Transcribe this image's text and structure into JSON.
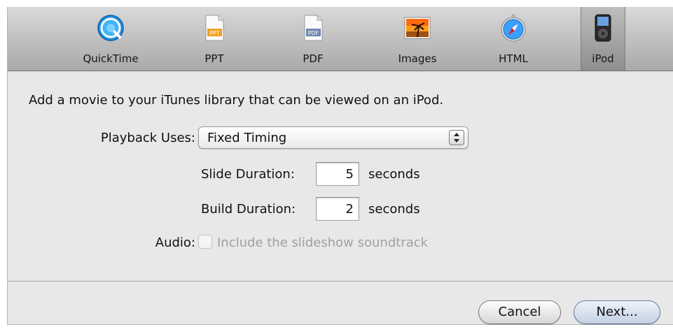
{
  "toolbar": {
    "tabs": [
      {
        "label": "QuickTime",
        "icon": "quicktime-icon"
      },
      {
        "label": "PPT",
        "icon": "ppt-document-icon",
        "badge": "PPT"
      },
      {
        "label": "PDF",
        "icon": "pdf-document-icon",
        "badge": "PDF"
      },
      {
        "label": "Images",
        "icon": "beach-photo-icon"
      },
      {
        "label": "HTML",
        "icon": "safari-compass-icon"
      },
      {
        "label": "iPod",
        "icon": "ipod-icon"
      }
    ],
    "selected_tab": "iPod"
  },
  "main": {
    "description": "Add a movie to your iTunes library that can be viewed on an iPod.",
    "playback": {
      "label": "Playback Uses:",
      "value": "Fixed Timing"
    },
    "slide_duration": {
      "label": "Slide Duration:",
      "value": "5",
      "unit": "seconds"
    },
    "build_duration": {
      "label": "Build Duration:",
      "value": "2",
      "unit": "seconds"
    },
    "audio": {
      "label": "Audio:",
      "checkbox_label": "Include the slideshow soundtrack",
      "checked": false,
      "enabled": false
    }
  },
  "footer": {
    "cancel_label": "Cancel",
    "next_label": "Next..."
  },
  "colors": {
    "toolbar_top": "#d9d9d9",
    "toolbar_bottom": "#a9a9a9",
    "panel_bg": "#e8e8e8",
    "disabled_text": "#a0a0a0",
    "default_button": "#c4d0e2"
  }
}
